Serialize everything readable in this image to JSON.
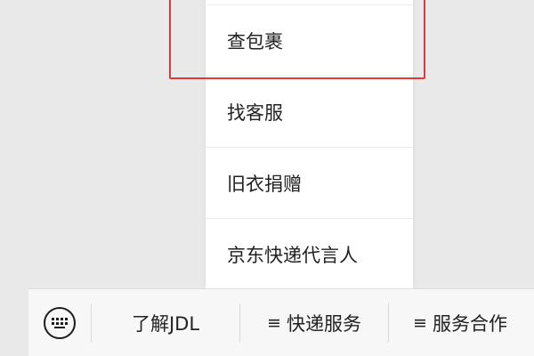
{
  "menu": {
    "items": [
      {
        "label": ""
      },
      {
        "label": "查包裹"
      },
      {
        "label": "找客服"
      },
      {
        "label": "旧衣捐赠"
      },
      {
        "label": "京东快递代言人"
      }
    ]
  },
  "bottom_bar": {
    "keyboard_icon": "keyboard-icon",
    "buttons": [
      {
        "label": "了解JDL",
        "icon": ""
      },
      {
        "label": "快递服务",
        "icon": "≡"
      },
      {
        "label": "服务合作",
        "icon": "≡"
      }
    ]
  },
  "highlight_color": "#e0393c"
}
